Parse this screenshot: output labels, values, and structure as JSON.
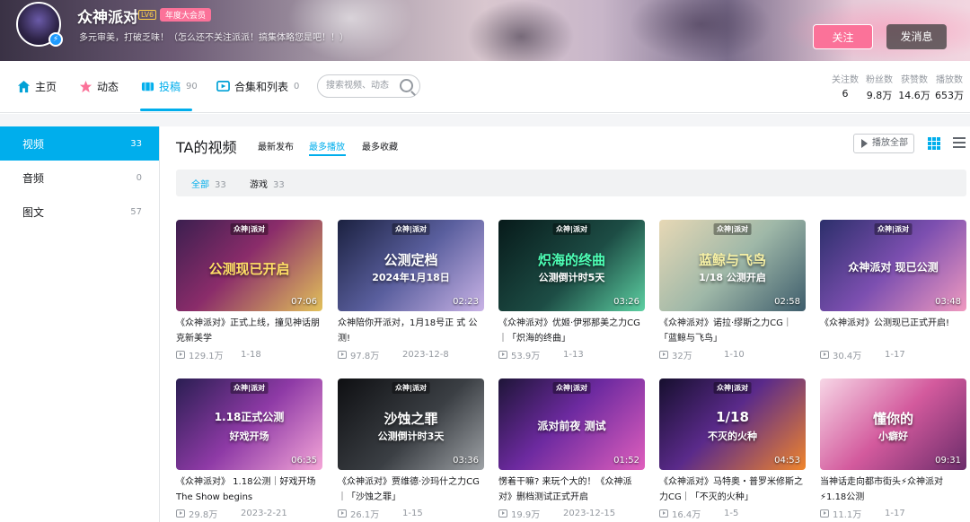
{
  "profile": {
    "name": "众神派对",
    "level": "LV6",
    "vip_badge": "年度大会员",
    "signature": "多元审美，打破乏味！（怎么还不关注派派！搞集体略您是吧！！）",
    "follow_label": "关注",
    "message_label": "发消息"
  },
  "nav": {
    "home": "主页",
    "dynamic": "动态",
    "upload": "投稿",
    "upload_count": "90",
    "collections": "合集和列表",
    "collections_count": "0",
    "search_placeholder": "搜索视频、动态"
  },
  "stats": [
    {
      "label": "关注数",
      "value": "6"
    },
    {
      "label": "粉丝数",
      "value": "9.8万"
    },
    {
      "label": "获赞数",
      "value": "14.6万"
    },
    {
      "label": "播放数",
      "value": "653万"
    }
  ],
  "sidebar": [
    {
      "label": "视频",
      "count": "33"
    },
    {
      "label": "音频",
      "count": "0"
    },
    {
      "label": "图文",
      "count": "57"
    }
  ],
  "content": {
    "title": "TA的视频",
    "sort_latest": "最新发布",
    "sort_most_played": "最多播放",
    "sort_most_fav": "最多收藏",
    "play_all": "播放全部",
    "filter_all": "全部",
    "filter_all_count": "33",
    "filter_game": "游戏",
    "filter_game_count": "33"
  },
  "videos": [
    {
      "title": "《众神派对》正式上线，撞见神话朋克新美学",
      "views": "129.1万",
      "date": "1-18",
      "duration": "07:06",
      "logo": "众神|派对",
      "caption": "公测现已开启"
    },
    {
      "title": "众神陪你开派对，1月18号正 式 公测!",
      "views": "97.8万",
      "date": "2023-12-8",
      "duration": "02:23",
      "logo": "众神|派对",
      "caption": "公测定档",
      "caption2": "2024年1月18日"
    },
    {
      "title": "《众神派对》优姬·伊邪那美之力CG｜「炽海的终曲」",
      "views": "53.9万",
      "date": "1-13",
      "duration": "03:26",
      "logo": "众神|派对",
      "caption": "炽海的终曲",
      "caption2": "公测倒计时5天"
    },
    {
      "title": "《众神派对》诺拉·缪斯之力CG｜「蓝鲸与飞鸟」",
      "views": "32万",
      "date": "1-10",
      "duration": "02:58",
      "logo": "众神|派对",
      "caption": "蓝鲸与飞鸟",
      "caption2": "1/18 公测开启"
    },
    {
      "title": "《众神派对》公测现已正式开启!",
      "views": "30.4万",
      "date": "1-17",
      "duration": "03:48",
      "logo": "众神|派对",
      "caption": "众神派对 现已公测"
    },
    {
      "title": "《众神派对》 1.18公测｜好戏开场 The Show begins",
      "views": "29.8万",
      "date": "2023-2-21",
      "duration": "06:35",
      "logo": "众神|派对",
      "caption": "1.18正式公测",
      "caption2": "好戏开场"
    },
    {
      "title": "《众神派对》贾维德·沙玛什之力CG｜「沙蚀之罪」",
      "views": "26.1万",
      "date": "1-15",
      "duration": "03:36",
      "logo": "众神|派对",
      "caption": "沙蚀之罪",
      "caption2": "公测倒计时3天"
    },
    {
      "title": "愣着干嘛? 来玩个大的！《众神派对》删档测试正式开启",
      "views": "19.9万",
      "date": "2023-12-15",
      "duration": "01:52",
      "logo": "众神|派对",
      "caption": "派对前夜 测试"
    },
    {
      "title": "《众神派对》马特奥・普罗米修斯之力CG｜「不灭的火种」",
      "views": "16.4万",
      "date": "1-5",
      "duration": "04:53",
      "logo": "众神|派对",
      "caption": "1/18",
      "caption2": "不灭的火种"
    },
    {
      "title": "当神话走向都市街头⚡众神派对⚡1.18公测",
      "views": "11.1万",
      "date": "1-17",
      "duration": "09:31",
      "logo": "",
      "caption": "懂你的",
      "caption2": "小癖好"
    }
  ],
  "colors": {
    "accent": "#00aeec",
    "pink": "#fb7299"
  }
}
